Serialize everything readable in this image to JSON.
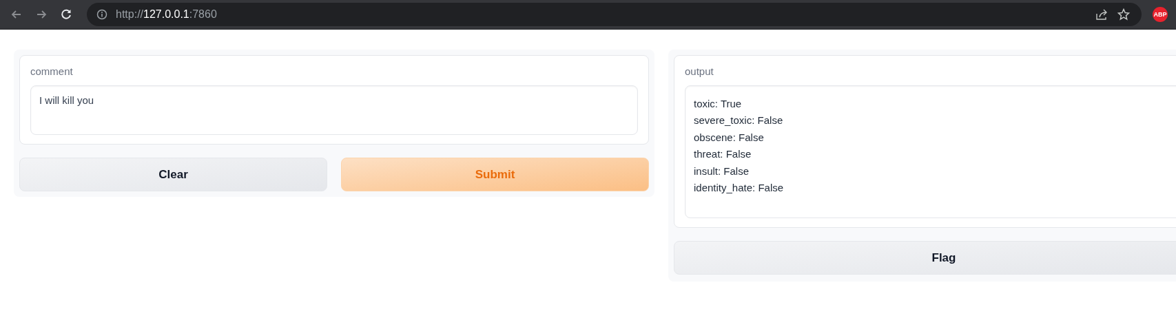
{
  "browser": {
    "url": {
      "scheme": "http://",
      "host": "127.0.0.1",
      "port": ":7860"
    },
    "back_disabled": true,
    "forward_disabled": true,
    "extension_badge": "ABP"
  },
  "input_panel": {
    "label": "comment",
    "value": "I will kill you",
    "buttons": [
      {
        "label": "Clear",
        "kind": "secondary"
      },
      {
        "label": "Submit",
        "kind": "primary"
      }
    ]
  },
  "output_panel": {
    "label": "output",
    "lines": [
      "toxic: True",
      "severe_toxic: False",
      "obscene: False",
      "threat: False",
      "insult: False",
      "identity_hate: False"
    ],
    "buttons": [
      {
        "label": "Flag",
        "kind": "secondary"
      }
    ]
  }
}
